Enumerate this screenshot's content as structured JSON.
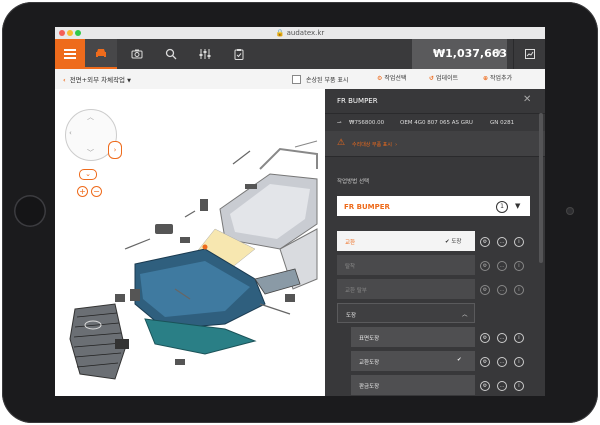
{
  "browser": {
    "url": "audatex.kr"
  },
  "toolbar": {
    "price": "₩1,037,663",
    "icons": [
      "menu-icon",
      "car-icon",
      "camera-icon",
      "search-icon",
      "sliders-icon",
      "clipboard-icon",
      "document-chart-icon"
    ]
  },
  "subbar": {
    "breadcrumb": "전면+외부 차체작업",
    "checkbox_label": "손상된 부품 표시",
    "settings_label": "작업선택",
    "undo_label": "업데이트",
    "add_label": "작업추가"
  },
  "panel": {
    "title": "FR BUMPER",
    "info": {
      "price": "₩756800.00",
      "oem": "OEM 4G0 807 065 AS GRU",
      "gn": "GN 0281"
    },
    "warning": "수리대상 부품 표시",
    "select_label": "작업방법 선택",
    "dropdown": {
      "value": "FR BUMPER",
      "count": "1"
    },
    "rows": [
      {
        "label": "교환",
        "right": "✔ 도장"
      },
      {
        "label": "탈착"
      },
      {
        "label": "교환 탈부"
      },
      {
        "label": "도장"
      },
      {
        "label": "표면도장"
      },
      {
        "label": "교환도장",
        "right": "✔"
      },
      {
        "label": "판금도장"
      }
    ]
  },
  "colors": {
    "accent": "#ee6b1c",
    "toolbar": "#3a3a3c",
    "panel": "#38383a"
  }
}
